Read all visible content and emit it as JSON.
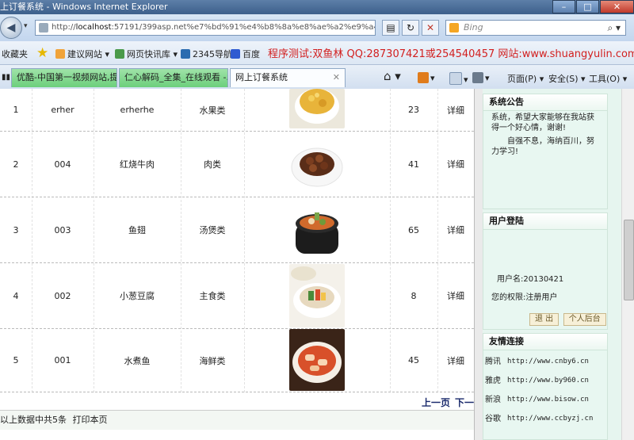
{
  "window": {
    "title": "上订餐系统 - Windows Internet Explorer",
    "controls": [
      "–",
      "□",
      "✕"
    ]
  },
  "addressbar": {
    "url_prefix": "http://",
    "url_host": "localhost",
    "url_rest": ":57191/399asp.net%e7%bd%91%e4%b8%8a%e8%ae%a2%e9%a4%90",
    "search_placeholder": "Bing"
  },
  "favorites": {
    "label": "收藏夹",
    "items": [
      "建议网站 ▾",
      "网页快讯库 ▾",
      "2345导航",
      "百度"
    ],
    "promo": "程序测试:双鱼林 QQ:287307421或254540457 网站:www.shuangyulin.com"
  },
  "tabs": [
    {
      "label": "优酷-中国第一视频网站,提..."
    },
    {
      "label": "仁心解码_全集_在线观看 -..."
    },
    {
      "label": "网上订餐系统"
    }
  ],
  "toolbar": {
    "page": "页面(P) ▾",
    "safety": "安全(S) ▾",
    "tools": "工具(O) ▾"
  },
  "table": {
    "rows": [
      {
        "index": "1",
        "code": "erher",
        "name": "erherhe",
        "category": "水果类",
        "qty": "23",
        "action": "详细"
      },
      {
        "index": "2",
        "code": "004",
        "name": "红烧牛肉",
        "category": "肉类",
        "qty": "41",
        "action": "详细"
      },
      {
        "index": "3",
        "code": "003",
        "name": "鱼翅",
        "category": "汤煲类",
        "qty": "65",
        "action": "详细"
      },
      {
        "index": "4",
        "code": "002",
        "name": "小葱豆腐",
        "category": "主食类",
        "qty": "8",
        "action": "详细"
      },
      {
        "index": "5",
        "code": "001",
        "name": "水煮鱼",
        "category": "海鲜类",
        "qty": "45",
        "action": "详细"
      }
    ]
  },
  "pager": {
    "prev": "上一页",
    "next": "下一页"
  },
  "footer": {
    "text": "以上数据中共5条",
    "print": "打印本页"
  },
  "sidebar": {
    "notice": {
      "title": "系统公告",
      "line1": "系统，希望大家能够在我站获得一个好心情，谢谢!",
      "line2": "自强不息，海纳百川，努力学习!"
    },
    "login": {
      "title": "用户登陆",
      "username": "用户名:20130421",
      "role": "您的权限:注册用户",
      "logout": "退 出",
      "profile": "个人后台"
    },
    "links": {
      "title": "友情连接",
      "items": [
        {
          "name": "腾讯",
          "url": "http://www.cnby6.cn"
        },
        {
          "name": "雅虎",
          "url": "http://www.by960.cn"
        },
        {
          "name": "新浪",
          "url": "http://www.bisow.cn"
        },
        {
          "name": "谷歌",
          "url": "http://www.ccbyzj.cn"
        }
      ]
    }
  }
}
